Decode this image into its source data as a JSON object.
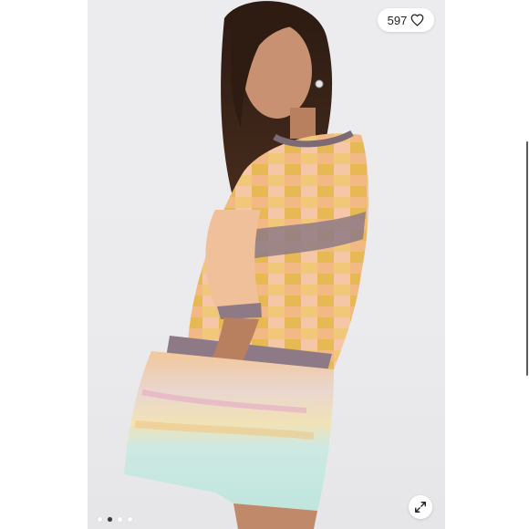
{
  "listing": {
    "like_count": "597",
    "like_icon": "heart-outline-icon",
    "expand_icon": "expand-arrows-icon"
  },
  "carousel": {
    "total_slides": 4,
    "active_slide": 2
  },
  "colors": {
    "background": "#ffffff",
    "photo_backdrop": "#ebebed",
    "active_dot": "#3a3a3a",
    "inactive_dot": "#ffffff"
  }
}
